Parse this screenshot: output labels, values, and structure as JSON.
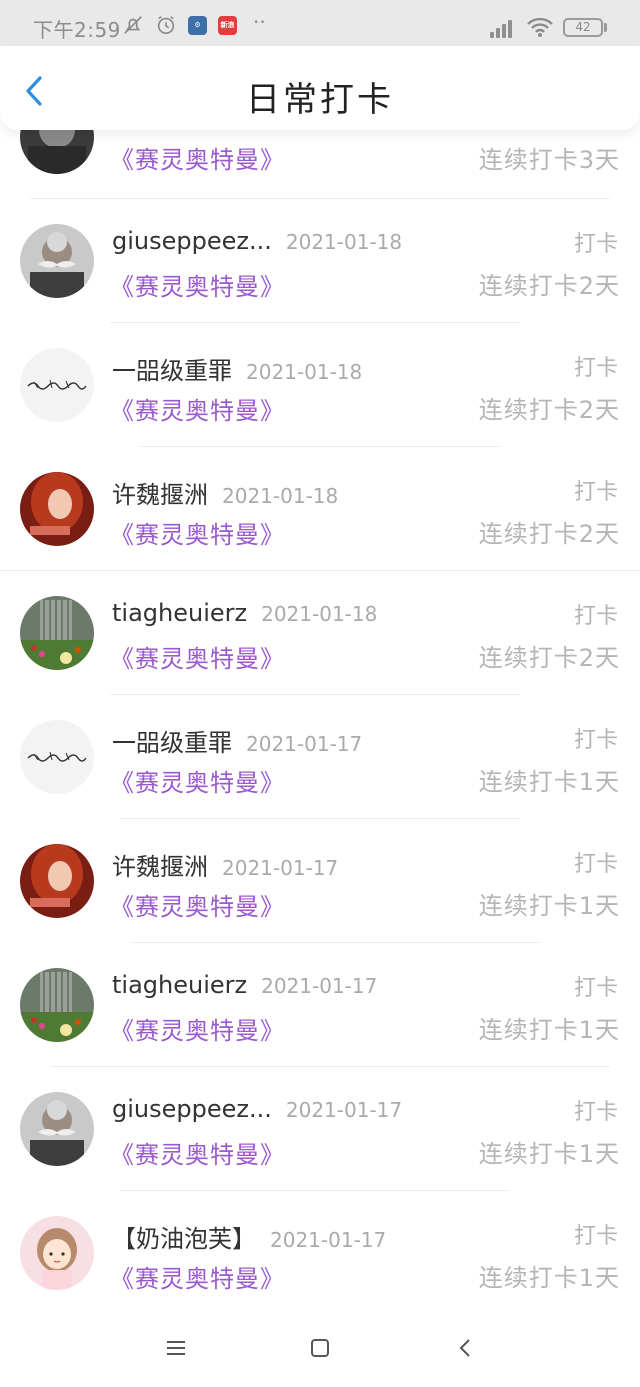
{
  "status_bar": {
    "time": "下午2:59",
    "battery": "42",
    "icons": [
      "mute-icon",
      "alarm-icon",
      "app-icon",
      "news-app-icon",
      "more-icon",
      "signal-icon",
      "wifi-icon",
      "battery-icon"
    ],
    "news_app_label": "新浪",
    "dots": "··"
  },
  "nav": {
    "title": "日常打卡",
    "back_icon": "chevron-left-icon"
  },
  "partial_row": {
    "sub": "《赛灵奥特曼》",
    "streak": "连续打卡3天"
  },
  "rows": [
    {
      "name": "giuseppeez...",
      "date": "2021-01-18",
      "status": "打卡",
      "sub": "《赛灵奥特曼》",
      "streak": "连续打卡2天",
      "avatar": "mustache-man"
    },
    {
      "name": "一㗊级重罪",
      "date": "2021-01-18",
      "status": "打卡",
      "sub": "《赛灵奥特曼》",
      "streak": "连续打卡2天",
      "avatar": "calligraphy"
    },
    {
      "name": "许魏揠洲",
      "date": "2021-01-18",
      "status": "打卡",
      "sub": "《赛灵奥特曼》",
      "streak": "连续打卡2天",
      "avatar": "red-hair-girl"
    },
    {
      "name": "tiagheuierz",
      "date": "2021-01-18",
      "status": "打卡",
      "sub": "《赛灵奥特曼》",
      "streak": "连续打卡2天",
      "avatar": "garden"
    },
    {
      "name": "一㗊级重罪",
      "date": "2021-01-17",
      "status": "打卡",
      "sub": "《赛灵奥特曼》",
      "streak": "连续打卡1天",
      "avatar": "calligraphy"
    },
    {
      "name": "许魏揠洲",
      "date": "2021-01-17",
      "status": "打卡",
      "sub": "《赛灵奥特曼》",
      "streak": "连续打卡1天",
      "avatar": "red-hair-girl"
    },
    {
      "name": "tiagheuierz",
      "date": "2021-01-17",
      "status": "打卡",
      "sub": "《赛灵奥特曼》",
      "streak": "连续打卡1天",
      "avatar": "garden"
    },
    {
      "name": "giuseppeez...",
      "date": "2021-01-17",
      "status": "打卡",
      "sub": "《赛灵奥特曼》",
      "streak": "连续打卡1天",
      "avatar": "mustache-man"
    },
    {
      "name": "【奶油泡芙】",
      "date": "2021-01-17",
      "status": "打卡",
      "sub": "《赛灵奥特曼》",
      "streak": "连续打卡1天",
      "avatar": "cartoon-girl"
    }
  ],
  "system_nav": [
    "menu-icon",
    "home-icon",
    "back-icon"
  ],
  "colors": {
    "accent_purple": "#9b59d0",
    "back_blue": "#2b8fe0",
    "muted_gray": "#b5b5b5",
    "status_bar_bg": "#e9e9e9"
  }
}
